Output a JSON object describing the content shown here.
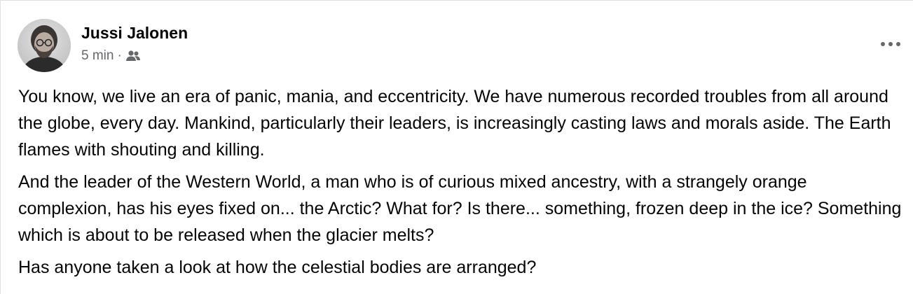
{
  "post": {
    "author": "Jussi Jalonen",
    "timestamp": "5 min",
    "separator": "·",
    "audience_icon": "friends-icon",
    "more_icon": "more-horizontal-icon",
    "paragraphs": [
      "You know, we live an era of panic, mania, and eccentricity. We have numerous recorded troubles from all around the globe, every day. Mankind, particularly their leaders, is increasingly casting laws and morals aside. The Earth flames with shouting and killing.",
      "And the leader of the Western World, a man who is of curious mixed ancestry, with a strangely orange complexion, has his eyes fixed on... the Arctic? What for? Is there... something, frozen deep in the ice? Something which is about to be released when the glacier melts?",
      "Has anyone taken a look at how the celestial bodies are arranged?"
    ]
  },
  "colors": {
    "text": "#050505",
    "secondary_text": "#65676b",
    "border": "#dcdfe3",
    "background": "#ffffff"
  }
}
